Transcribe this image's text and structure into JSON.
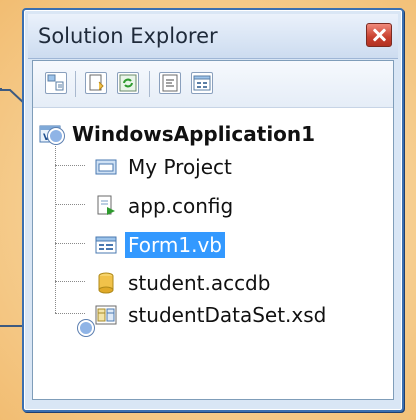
{
  "window": {
    "title": "Solution Explorer"
  },
  "toolbar": {
    "buttons": [
      {
        "name": "show-all-files"
      },
      {
        "name": "properties"
      },
      {
        "name": "refresh"
      },
      {
        "name": "view-code"
      },
      {
        "name": "view-designer"
      }
    ]
  },
  "tree": {
    "root": "WindowsApplication1",
    "items": [
      {
        "label": "My Project",
        "icon": "my-project-icon"
      },
      {
        "label": "app.config",
        "icon": "config-file-icon"
      },
      {
        "label": "Form1.vb",
        "icon": "form-icon",
        "selected": true
      },
      {
        "label": "student.accdb",
        "icon": "database-icon"
      },
      {
        "label": "studentDataSet.xsd",
        "icon": "dataset-icon"
      }
    ]
  },
  "colors": {
    "selection": "#3399ff",
    "panel_border": "#3b6fb0",
    "close_button": "#c8402f"
  }
}
